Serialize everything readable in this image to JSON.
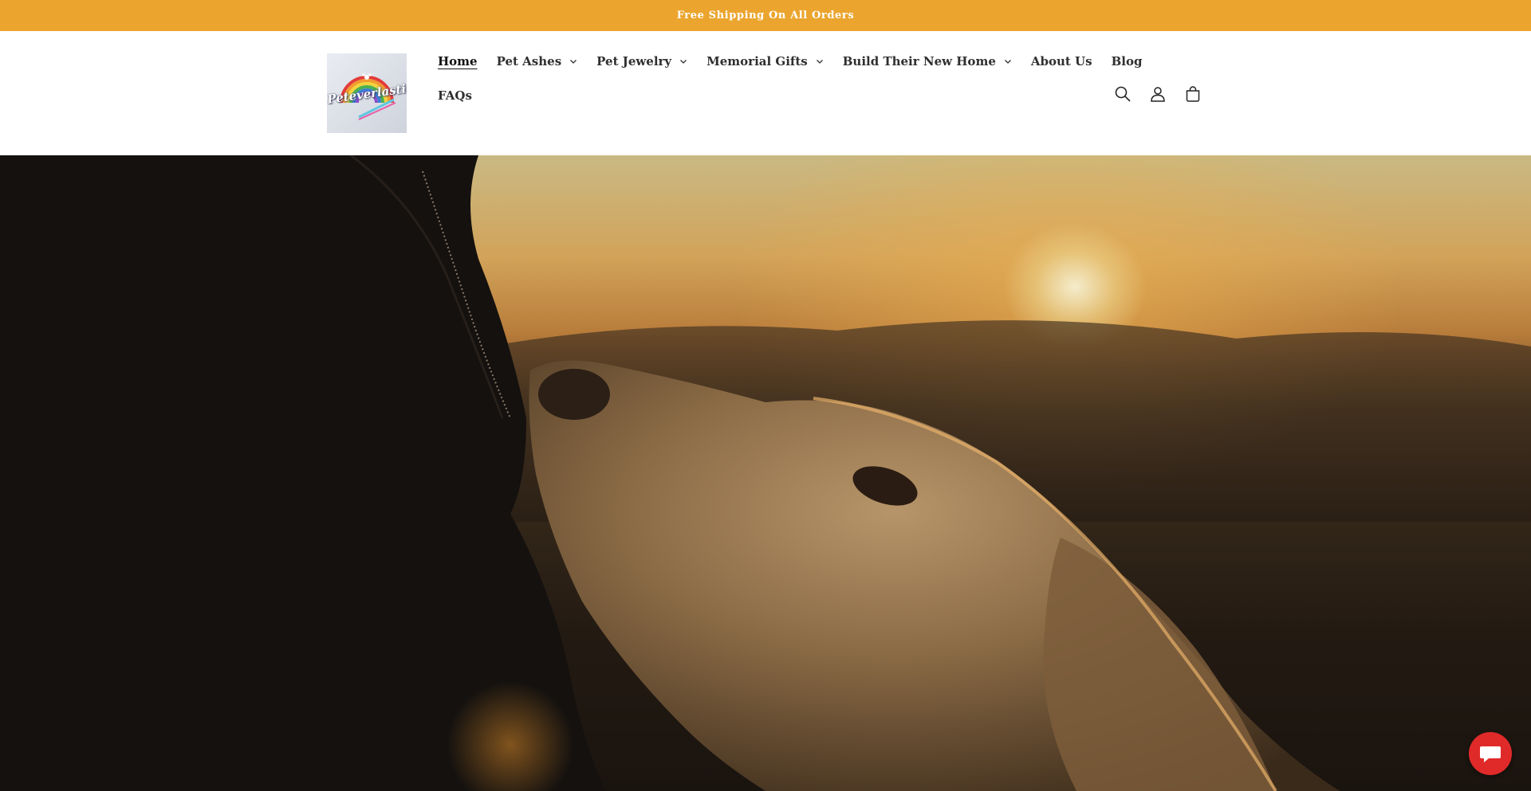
{
  "announcement": {
    "text": "Free Shipping On All Orders"
  },
  "brand": {
    "logo_text": "Peteverlasting"
  },
  "nav": {
    "row1": [
      {
        "label": "Home",
        "active": true,
        "dropdown": false
      },
      {
        "label": "Pet Ashes",
        "active": false,
        "dropdown": true
      },
      {
        "label": "Pet Jewelry",
        "active": false,
        "dropdown": true
      },
      {
        "label": "Memorial Gifts",
        "active": false,
        "dropdown": true
      },
      {
        "label": "Build Their New Home",
        "active": false,
        "dropdown": true
      },
      {
        "label": "About Us",
        "active": false,
        "dropdown": false
      },
      {
        "label": "Blog",
        "active": false,
        "dropdown": false
      }
    ],
    "row2": [
      {
        "label": "FAQs",
        "active": false,
        "dropdown": false
      }
    ]
  },
  "header_icons": [
    "search-icon",
    "account-icon",
    "cart-icon"
  ],
  "colors": {
    "announcement_bg": "#eba52e",
    "chat_bg": "#e02a2a"
  }
}
